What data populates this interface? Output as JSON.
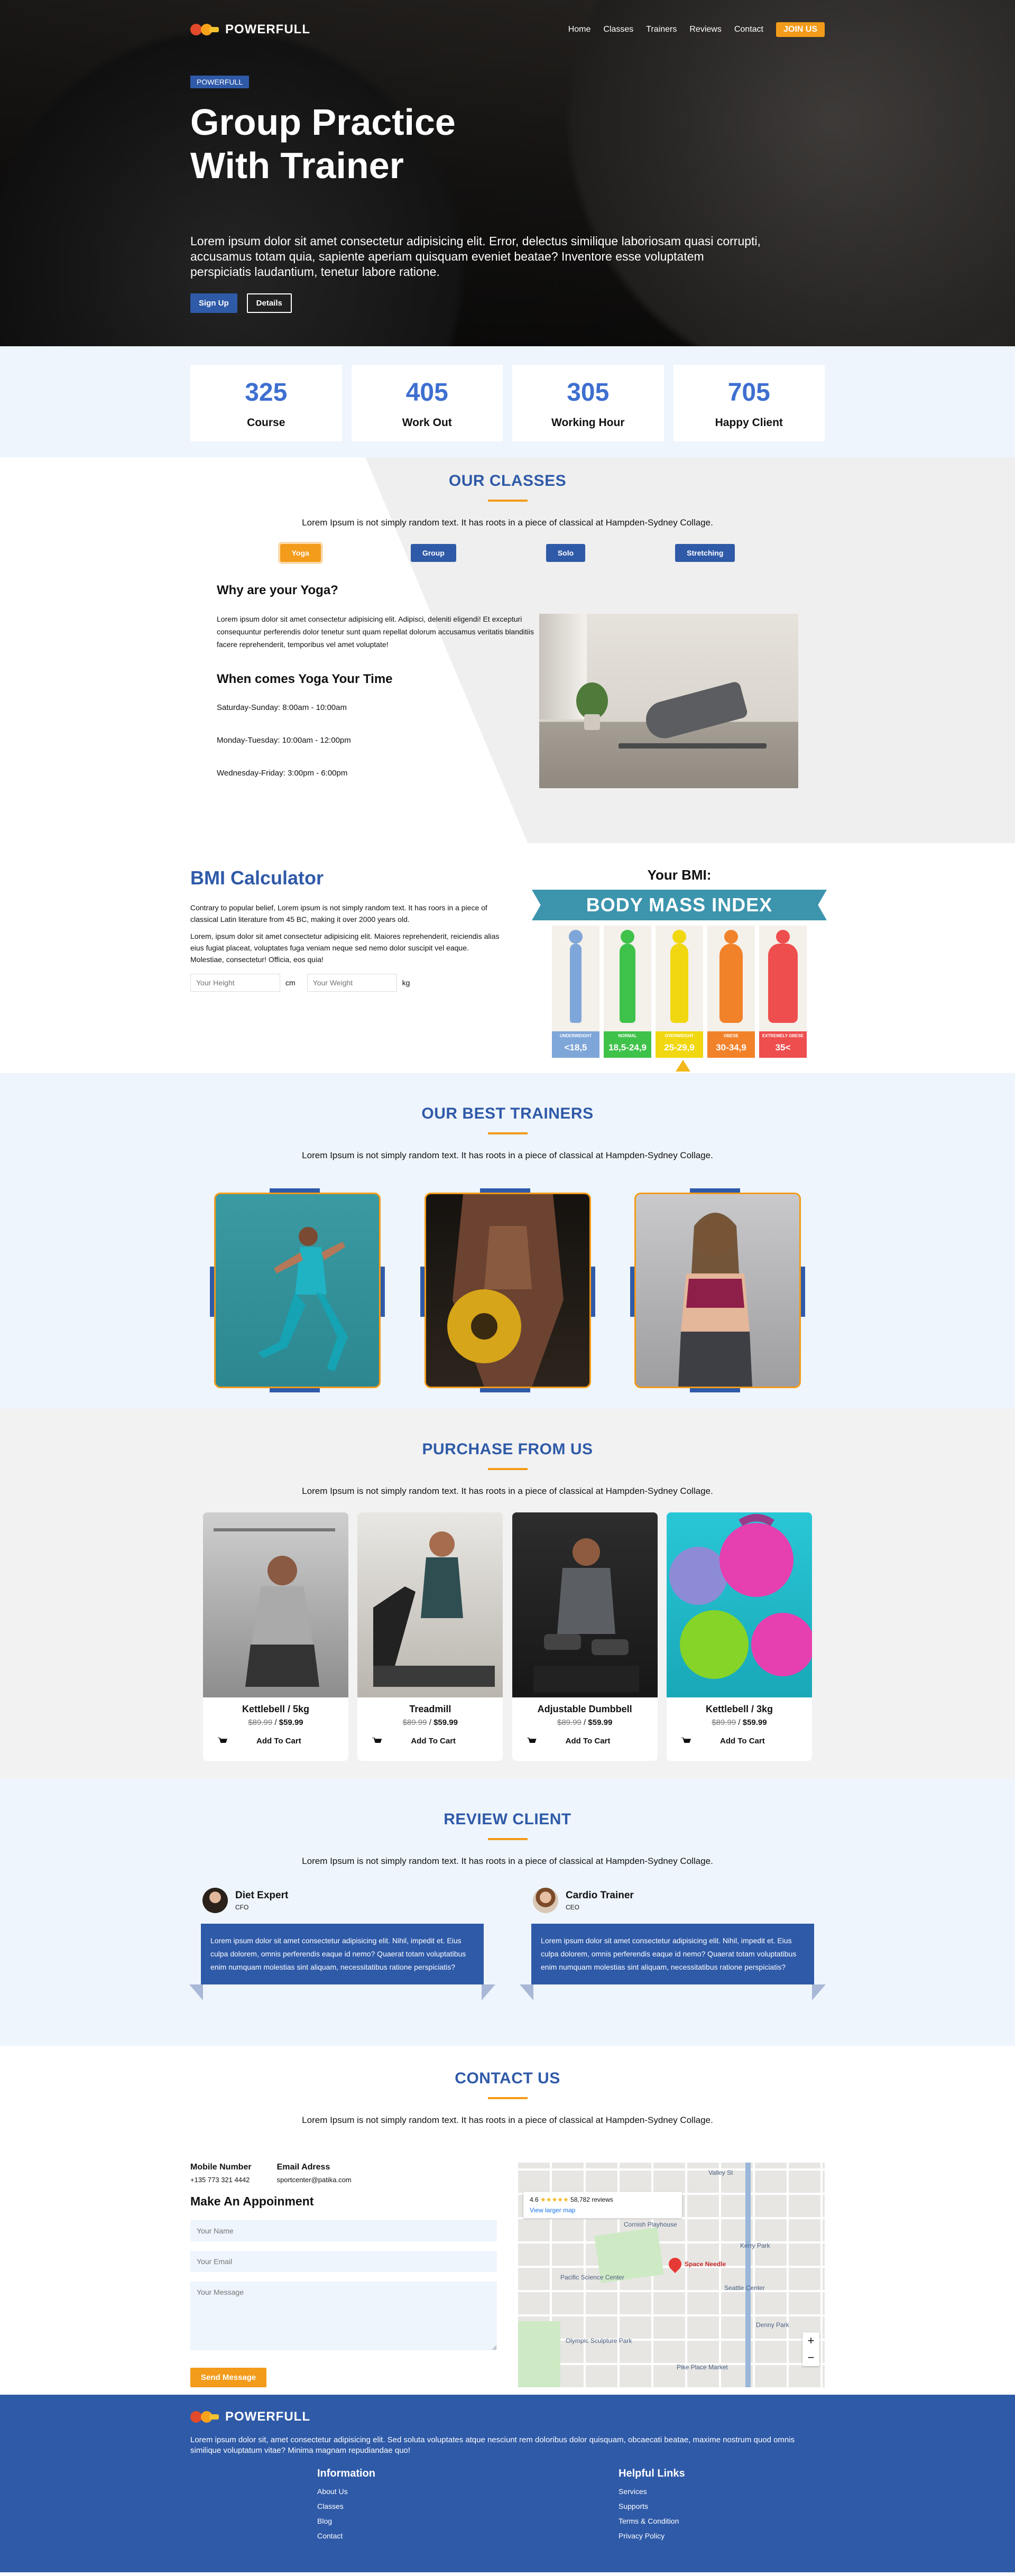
{
  "brand": {
    "name": "POWERFULL"
  },
  "nav": {
    "items": [
      "Home",
      "Classes",
      "Trainers",
      "Reviews",
      "Contact"
    ],
    "join": "JOIN US"
  },
  "hero": {
    "badge": "POWERFULL",
    "title": "Group Practice With Trainer",
    "text": "Lorem ipsum dolor sit amet consectetur adipisicing elit. Error, delectus similique laboriosam quasi corrupti, accusamus totam quia, sapiente aperiam quisquam eveniet beatae? Inventore esse voluptatem perspiciatis laudantium, tenetur labore ratione.",
    "signup": "Sign Up",
    "details": "Details"
  },
  "stats": [
    {
      "num": "325",
      "label": "Course"
    },
    {
      "num": "405",
      "label": "Work Out"
    },
    {
      "num": "305",
      "label": "Working Hour"
    },
    {
      "num": "705",
      "label": "Happy Client"
    }
  ],
  "classes": {
    "title": "OUR CLASSES",
    "sub": "Lorem Ipsum is not simply random text. It has roots in a piece of classical at Hampden-Sydney Collage.",
    "tabs": [
      "Yoga",
      "Group",
      "Solo",
      "Stretching"
    ],
    "why_title": "Why are your Yoga?",
    "why_text": "Lorem ipsum dolor sit amet consectetur adipisicing elit. Adipisci, deleniti eligendi! Et excepturi consequuntur perferendis dolor tenetur sunt quam repellat dolorum accusamus veritatis blanditiis facere reprehenderit, temporibus vel amet voluptate!",
    "when_title": "When comes Yoga Your Time",
    "times": [
      "Saturday-Sunday: 8:00am - 10:00am",
      "Monday-Tuesday: 10:00am - 12:00pm",
      "Wednesday-Friday: 3:00pm - 6:00pm"
    ]
  },
  "bmi": {
    "title": "BMI Calculator",
    "p1": "Contrary to popular belief, Lorem ipsum is not simply random text. It has roors in a piece of classical Latin literature from 45 BC, making it over 2000 years old.",
    "p2": "Lorem, ipsum dolor sit amet consectetur adipisicing elit. Maiores reprehenderit, reiciendis alias eius fugiat placeat, voluptates fuga veniam neque sed nemo dolor suscipit vel eaque. Molestiae, consectetur! Officia, eos quia!",
    "height_placeholder": "Your Height",
    "height_unit": "cm",
    "weight_placeholder": "Your Weight",
    "weight_unit": "kg",
    "your_bmi": "Your BMI:",
    "banner": "BODY MASS INDEX",
    "categories": [
      {
        "name": "UNDERWEIGHT",
        "range": "<18,5",
        "color": "#7fa6d8"
      },
      {
        "name": "NORMAL",
        "range": "18,5-24,9",
        "color": "#3fc24a"
      },
      {
        "name": "OVERWEIGHT",
        "range": "25-29,9",
        "color": "#f1d70f"
      },
      {
        "name": "OBESE",
        "range": "30-34,9",
        "color": "#f2822a"
      },
      {
        "name": "EXTREMELY OBESE",
        "range": "35<",
        "color": "#ee4e4e"
      }
    ]
  },
  "trainers": {
    "title": "OUR BEST TRAINERS",
    "sub": "Lorem Ipsum is not simply random text. It has roots in a piece of classical at Hampden-Sydney Collage."
  },
  "purchase": {
    "title": "PURCHASE FROM US",
    "sub": "Lorem Ipsum is not simply random text. It has roots in a piece of classical at Hampden-Sydney Collage.",
    "cart_label": "Add To Cart",
    "products": [
      {
        "name": "Kettlebell / 5kg",
        "old": "$89.99",
        "price": "$59.99"
      },
      {
        "name": "Treadmill",
        "old": "$89.99",
        "price": "$59.99"
      },
      {
        "name": "Adjustable Dumbbell",
        "old": "$89.99",
        "price": "$59.99"
      },
      {
        "name": "Kettlebell / 3kg",
        "old": "$89.99",
        "price": "$59.99"
      }
    ]
  },
  "reviews": {
    "title": "REVIEW CLIENT",
    "sub": "Lorem Ipsum is not simply random text. It has roots in a piece of classical at Hampden-Sydney Collage.",
    "items": [
      {
        "name": "Diet Expert",
        "role": "CFO",
        "text": "Lorem ipsum dolor sit amet consectetur adipisicing elit. Nihil, impedit et. Eius culpa dolorem, omnis perferendis eaque id nemo? Quaerat totam voluptatibus enim numquam molestias sint aliquam, necessitatibus ratione perspiciatis?"
      },
      {
        "name": "Cardio Trainer",
        "role": "CEO",
        "text": "Lorem ipsum dolor sit amet consectetur adipisicing elit. Nihil, impedit et. Eius culpa dolorem, omnis perferendis eaque id nemo? Quaerat totam voluptatibus enim numquam molestias sint aliquam, necessitatibus ratione perspiciatis?"
      }
    ]
  },
  "contact": {
    "title": "CONTACT US",
    "sub": "Lorem Ipsum is not simply random text. It has roots in a piece of classical at Hampden-Sydney Collage.",
    "mobile_label": "Mobile Number",
    "mobile": "+135 773 321 4442",
    "email_label": "Email Adress",
    "email": "sportcenter@patika.com",
    "form_title": "Make An Appoinment",
    "name_placeholder": "Your Name",
    "email_placeholder": "Your Email",
    "message_placeholder": "Your Message",
    "send": "Send Message",
    "map": {
      "rating": "4.6",
      "reviews": "58,782 reviews",
      "larger": "View larger map",
      "place": "Space Needle",
      "labels": [
        "Valley St",
        "Pacific Science Center",
        "Cornish Playhouse",
        "Kerry Park",
        "Olympic Sculpture Park",
        "Seattle Center",
        "Denny Park",
        "Pike Place Market"
      ]
    }
  },
  "footer": {
    "desc": "Lorem ipsum dolor sit, amet consectetur adipisicing elit. Sed soluta voluptates atque nesciunt rem doloribus dolor quisquam, obcaecati beatae, maxime nostrum quod omnis similique voluptatum vitae? Minima magnam repudiandae quo!",
    "info_title": "Information",
    "info_links": [
      "About Us",
      "Classes",
      "Blog",
      "Contact"
    ],
    "help_title": "Helpful Links",
    "help_links": [
      "Services",
      "Supports",
      "Terms & Condition",
      "Privacy Policy"
    ]
  }
}
